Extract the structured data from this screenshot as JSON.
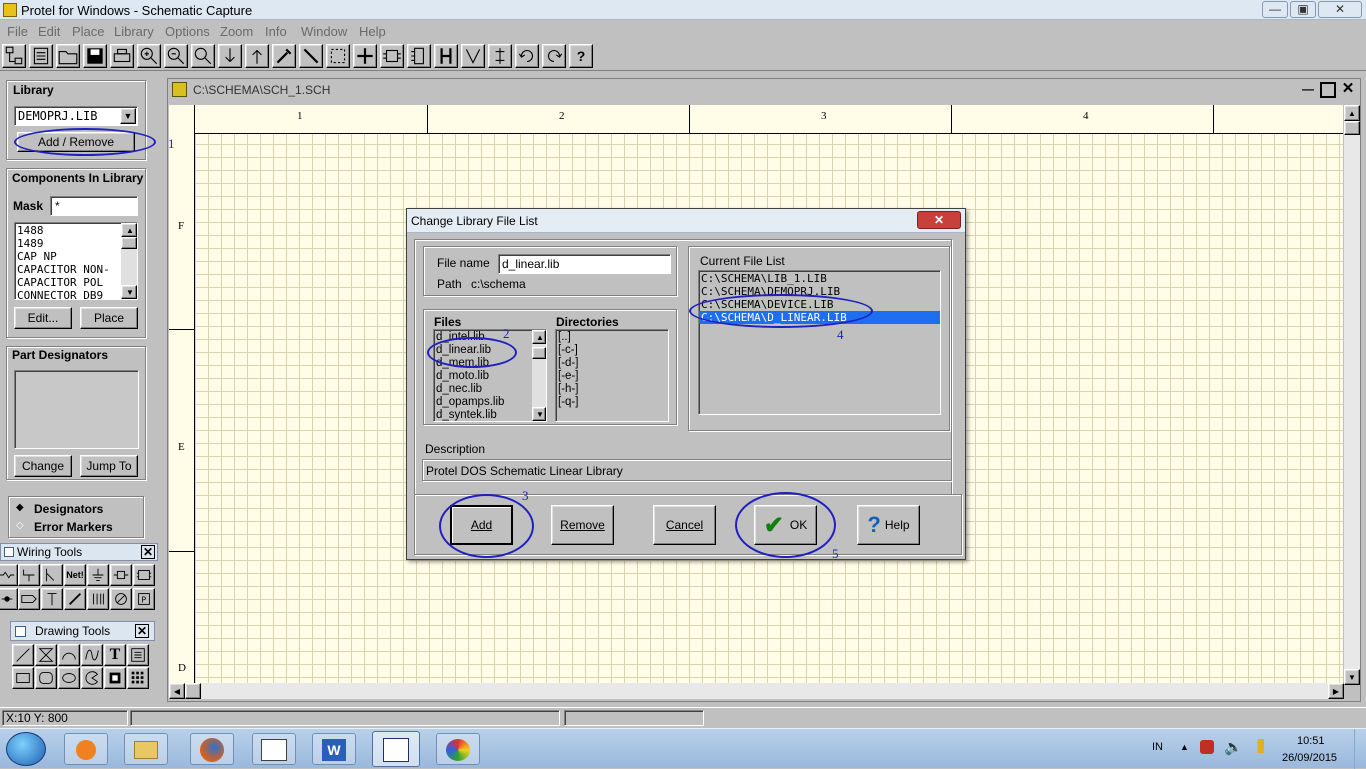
{
  "app": {
    "title": "Protel for Windows - Schematic Capture"
  },
  "menu": [
    "File",
    "Edit",
    "Place",
    "Library",
    "Options",
    "Zoom",
    "Info",
    "Window",
    "Help"
  ],
  "toolbar": {
    "icons": [
      "hierarchy-icon",
      "project-icon",
      "open-icon",
      "save-icon",
      "print-icon",
      "zoom-in-icon",
      "zoom-out-icon",
      "zoom-area-icon",
      "move-down-icon",
      "move-up-icon",
      "tool-icon",
      "wire-icon",
      "select-icon",
      "cross-icon",
      "component-icon",
      "part-icon",
      "bus-icon",
      "netlist-icon",
      "align-icon",
      "undo-icon",
      "redo-icon",
      "help-icon"
    ],
    "help_label": "?"
  },
  "library_panel": {
    "library_heading": "Library",
    "selected_library": "DEMOPRJ.LIB",
    "add_remove": "Add / Remove",
    "components_heading": "Components In Library",
    "mask_label": "Mask",
    "mask_value": "*",
    "components": [
      "1488",
      "1489",
      "CAP NP",
      "CAPACITOR NON-",
      "CAPACITOR POL",
      "CONNECTOR DB9"
    ],
    "edit": "Edit...",
    "place": "Place",
    "designators_heading": "Part Designators",
    "change": "Change",
    "jump_to": "Jump To",
    "radio_designators": "Designators",
    "radio_errors": "Error Markers"
  },
  "wiring_tools": {
    "title": "Wiring Tools",
    "net_label": "Net!"
  },
  "drawing_tools": {
    "title": "Drawing Tools",
    "text_tool": "T"
  },
  "document": {
    "title": "C:\\SCHEMA\\SCH_1.SCH",
    "columns": [
      "1",
      "2",
      "3",
      "4"
    ],
    "rows": [
      "F",
      "E",
      "D"
    ],
    "left_mark": "1"
  },
  "dialog": {
    "title": "Change Library File List",
    "file_name_label": "File name",
    "file_name_value": "d_linear.lib",
    "path_label": "Path",
    "path_value": "c:\\schema",
    "files_heading": "Files",
    "files": [
      "d_intel.lib",
      "d_linear.lib",
      "d_mem.lib",
      "d_moto.lib",
      "d_nec.lib",
      "d_opamps.lib",
      "d_syntek.lib"
    ],
    "directories_heading": "Directories",
    "directories": [
      "[..]",
      "[-c-]",
      "[-d-]",
      "[-e-]",
      "[-h-]",
      "[-q-]"
    ],
    "current_heading": "Current File List",
    "current_files": [
      "C:\\SCHEMA\\LIB_1.LIB",
      "C:\\SCHEMA\\DEMOPRJ.LIB",
      "C:\\SCHEMA\\DEVICE.LIB",
      "C:\\SCHEMA\\D_LINEAR.LIB"
    ],
    "description_heading": "Description",
    "description": "Protel DOS Schematic Linear Library",
    "add": "Add",
    "remove": "Remove",
    "cancel": "Cancel",
    "ok": "OK",
    "help": "Help"
  },
  "annotations": [
    "1",
    "2",
    "3",
    "4",
    "5"
  ],
  "status": {
    "coords": "X:10 Y: 800"
  },
  "taskbar": {
    "lang": "IN",
    "time": "10:51",
    "date": "26/09/2015"
  },
  "colors": {
    "accent": "#2020c0",
    "selection": "#1e6ff0",
    "sheet": "#fffde8",
    "grid": "#d8d4b0"
  }
}
